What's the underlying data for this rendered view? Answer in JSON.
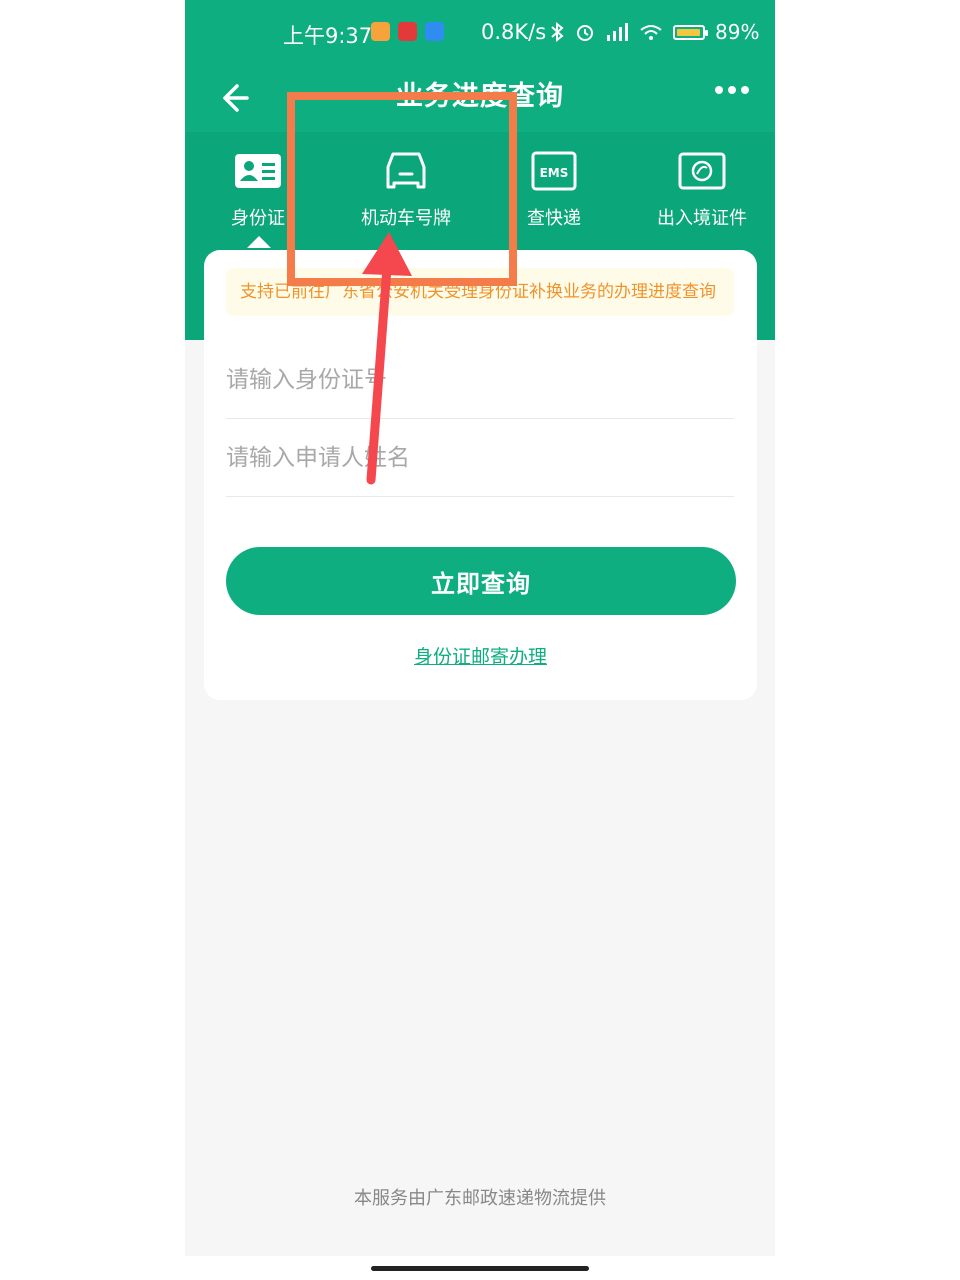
{
  "status_bar": {
    "time": "上午9:37",
    "net_speed": "0.8K/s",
    "battery": "89%"
  },
  "nav": {
    "title": "业务进度查询"
  },
  "tabs": [
    {
      "label": "身份证",
      "icon": "id-card-icon",
      "active": true
    },
    {
      "label": "机动车号牌",
      "icon": "car-icon",
      "active": false
    },
    {
      "label": "查快递",
      "icon": "ems-icon",
      "icon_text": "EMS",
      "active": false
    },
    {
      "label": "出入境证件",
      "icon": "passport-icon",
      "active": false
    }
  ],
  "notice": "支持已前往广东省公安机关受理身份证补换业务的办理进度查询",
  "form": {
    "id_placeholder": "请输入身份证号",
    "name_placeholder": "请输入申请人姓名",
    "submit_label": "立即查询"
  },
  "mail_link": "身份证邮寄办理",
  "footer": "本服务由广东邮政速递物流提供",
  "colors": {
    "primary": "#0fae80",
    "annotation": "#f47c4b",
    "arrow": "#f4474e"
  }
}
